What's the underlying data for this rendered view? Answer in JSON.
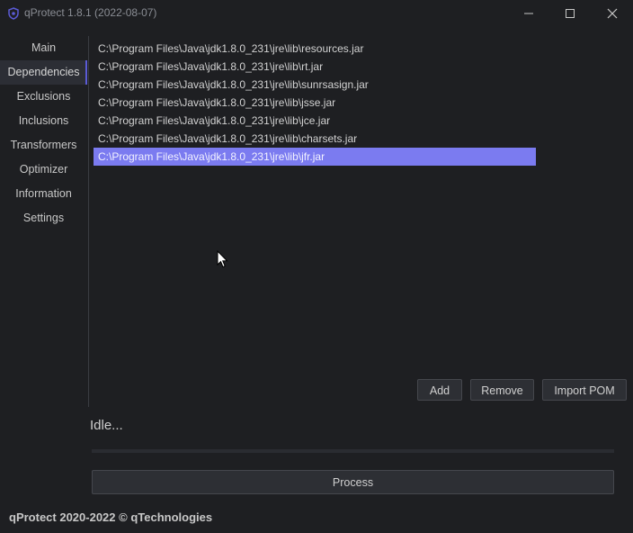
{
  "window": {
    "title": "qProtect 1.8.1 (2022-08-07)",
    "icon": "shield-icon",
    "controls": [
      "minimize-icon",
      "maximize-icon",
      "close-icon"
    ]
  },
  "sidebar": {
    "items": [
      {
        "label": "Main"
      },
      {
        "label": "Dependencies",
        "active": true
      },
      {
        "label": "Exclusions"
      },
      {
        "label": "Inclusions"
      },
      {
        "label": "Transformers"
      },
      {
        "label": "Optimizer"
      },
      {
        "label": "Information"
      },
      {
        "label": "Settings"
      }
    ]
  },
  "dependencies": {
    "items": [
      "C:\\Program Files\\Java\\jdk1.8.0_231\\jre\\lib\\resources.jar",
      "C:\\Program Files\\Java\\jdk1.8.0_231\\jre\\lib\\rt.jar",
      "C:\\Program Files\\Java\\jdk1.8.0_231\\jre\\lib\\sunrsasign.jar",
      "C:\\Program Files\\Java\\jdk1.8.0_231\\jre\\lib\\jsse.jar",
      "C:\\Program Files\\Java\\jdk1.8.0_231\\jre\\lib\\jce.jar",
      "C:\\Program Files\\Java\\jdk1.8.0_231\\jre\\lib\\charsets.jar",
      "C:\\Program Files\\Java\\jdk1.8.0_231\\jre\\lib\\jfr.jar"
    ],
    "selected_index": 6
  },
  "buttons": {
    "add": "Add",
    "remove": "Remove",
    "import_pom": "Import POM",
    "process": "Process"
  },
  "status": {
    "text": "Idle...",
    "progress": 0
  },
  "footer": {
    "text": "qProtect 2020-2022 © qTechnologies"
  },
  "colors": {
    "background": "#1e1f22",
    "accent": "#5b5bd6",
    "selection": "#7b7bf0"
  }
}
